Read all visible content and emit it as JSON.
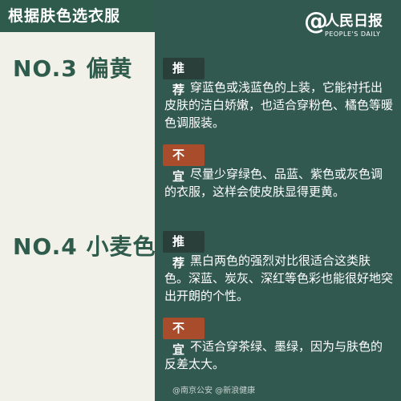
{
  "title": "根据肤色选衣服",
  "logo": {
    "name": "人民日报",
    "subtitle": "PEOPLE'S DAILY"
  },
  "sections": [
    {
      "label": "NO.3 偏黄",
      "recommend": {
        "tag": "推荐",
        "text": "穿蓝色或浅蓝色的上装，它能衬托出皮肤的洁白娇嫩，也适合穿粉色、橘色等暖色调服装。"
      },
      "avoid": {
        "tag": "不宜",
        "text": "尽量少穿绿色、品蓝、紫色或灰色调的衣服，这样会使皮肤显得更黄。"
      }
    },
    {
      "label": "NO.4 小麦色",
      "recommend": {
        "tag": "推荐",
        "text": "黑白两色的强烈对比很适合这类肤色。深蓝、炭灰、深红等色彩也能很好地突出开朗的个性。"
      },
      "avoid": {
        "tag": "不宜",
        "text": "不适合穿茶绿、墨绿，因为与肤色的反差太大。"
      }
    }
  ],
  "footer": "@南京公安  @新浪健康"
}
